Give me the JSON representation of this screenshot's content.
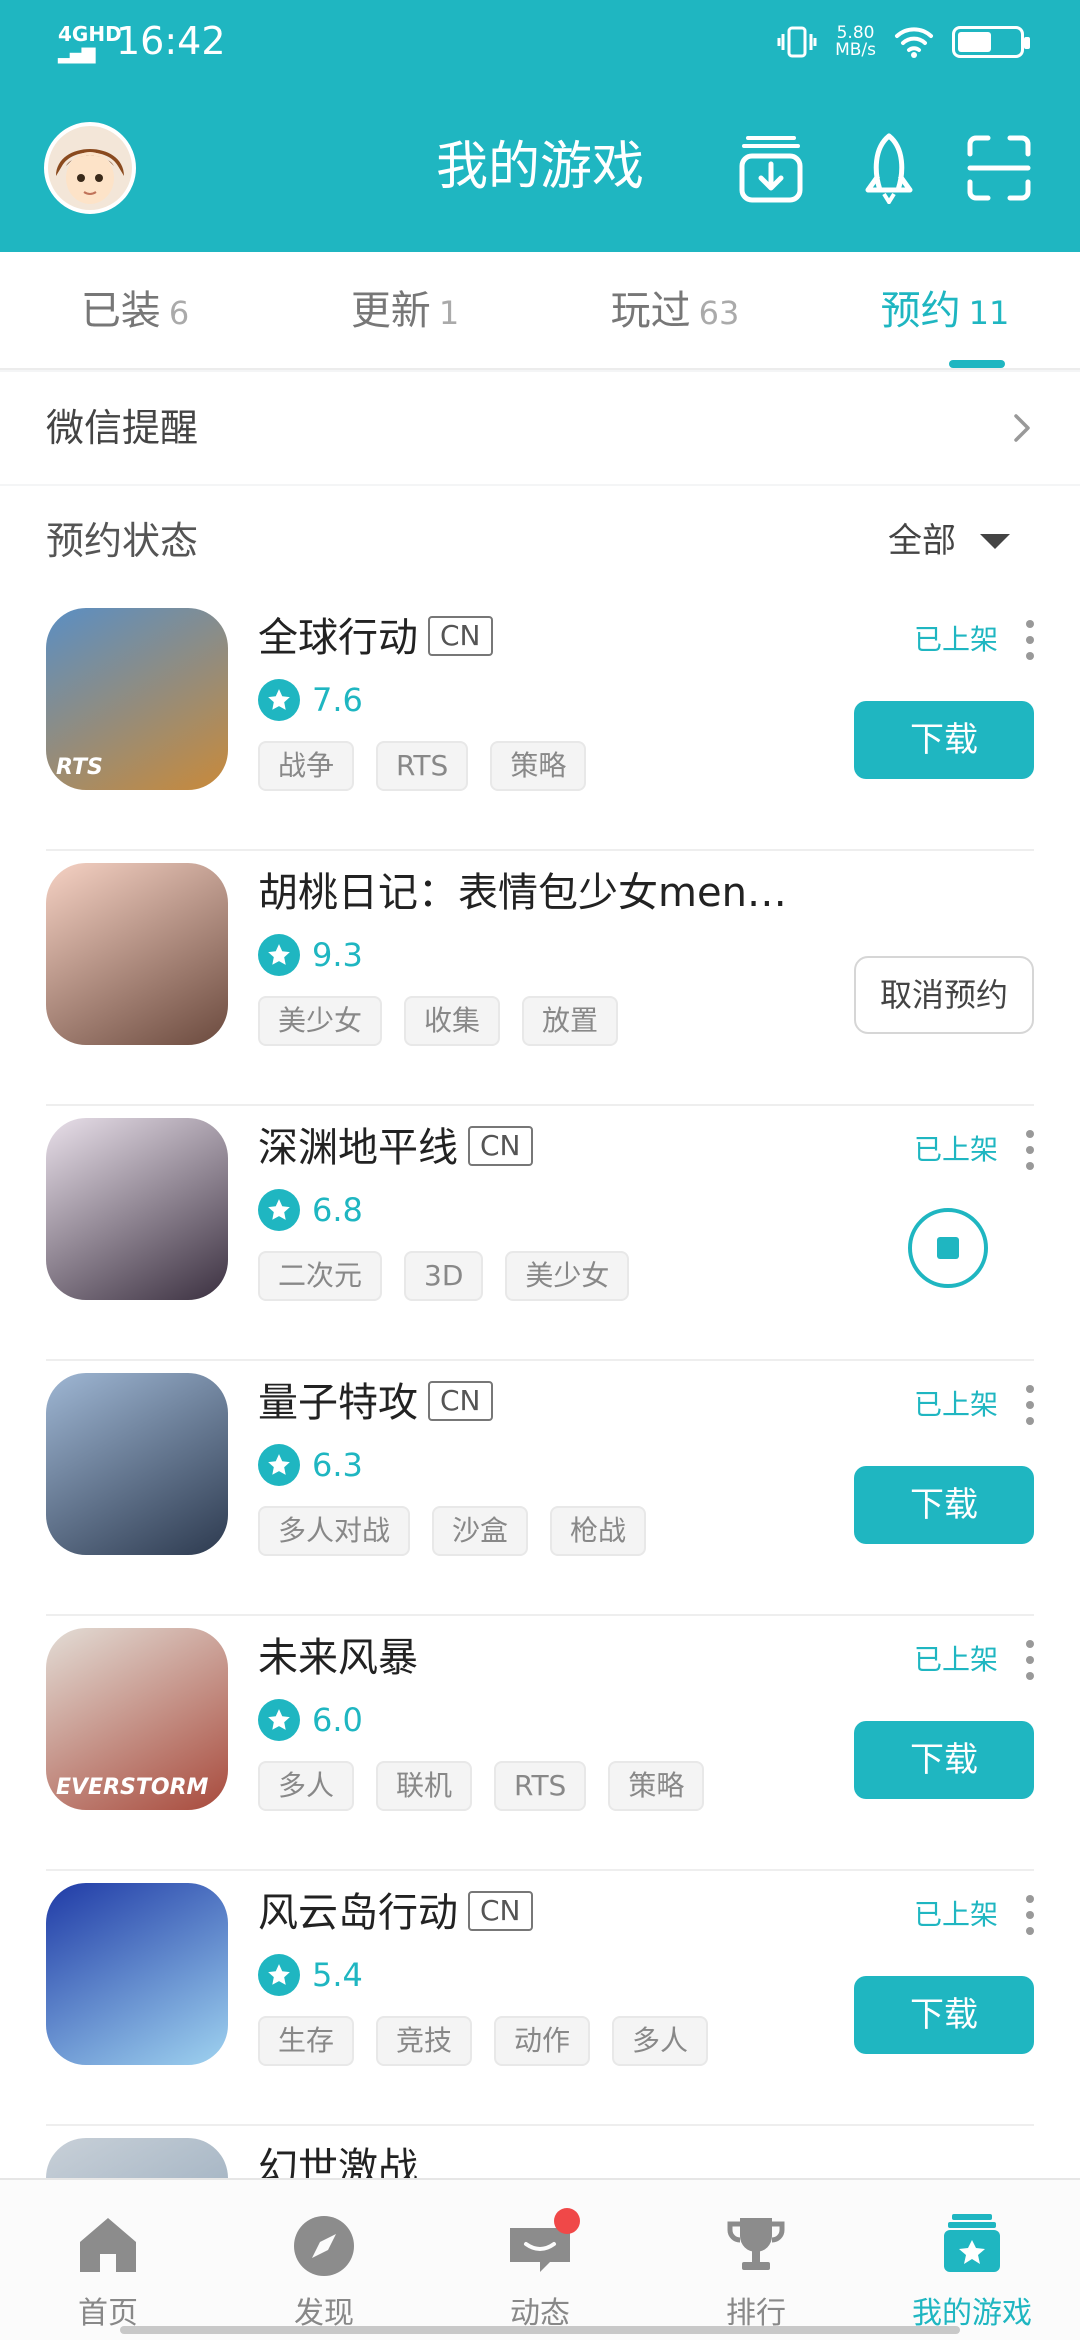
{
  "status_bar": {
    "network": "4GHD",
    "time": "16:42",
    "speed_value": "5.80",
    "speed_unit": "MB/s",
    "battery_level": 0.55
  },
  "header": {
    "title": "我的游戏"
  },
  "tabs": [
    {
      "label": "已装",
      "count": "6",
      "active": false
    },
    {
      "label": "更新",
      "count": "1",
      "active": false
    },
    {
      "label": "玩过",
      "count": "63",
      "active": false
    },
    {
      "label": "预约",
      "count": "11",
      "active": true
    }
  ],
  "wechat": {
    "label": "微信提醒"
  },
  "reservation": {
    "label": "预约状态",
    "filter": "全部"
  },
  "games": [
    {
      "name": "全球行动",
      "badge": "CN",
      "score": "7.6",
      "tags": [
        "战争",
        "RTS",
        "策略"
      ],
      "status": "已上架",
      "action": "download",
      "action_label": "下载",
      "icon_colors": [
        "#5a8fc4",
        "#c98a3a"
      ],
      "icon_text": "RTS"
    },
    {
      "name": "胡桃日记：表情包少女men…",
      "badge": "",
      "score": "9.3",
      "tags": [
        "美少女",
        "收集",
        "放置"
      ],
      "status": "",
      "action": "cancel",
      "action_label": "取消预约",
      "icon_colors": [
        "#f6d2c4",
        "#6b4a3e"
      ],
      "icon_text": ""
    },
    {
      "name": "深渊地平线",
      "badge": "CN",
      "score": "6.8",
      "tags": [
        "二次元",
        "3D",
        "美少女"
      ],
      "status": "已上架",
      "action": "stop",
      "action_label": "",
      "icon_colors": [
        "#e9e0ea",
        "#3b3040"
      ],
      "icon_text": ""
    },
    {
      "name": "量子特攻",
      "badge": "CN",
      "score": "6.3",
      "tags": [
        "多人对战",
        "沙盒",
        "枪战"
      ],
      "status": "已上架",
      "action": "download",
      "action_label": "下载",
      "icon_colors": [
        "#9fb7d4",
        "#2d3a4f"
      ],
      "icon_text": ""
    },
    {
      "name": "未来风暴",
      "badge": "",
      "score": "6.0",
      "tags": [
        "多人",
        "联机",
        "RTS",
        "策略"
      ],
      "status": "已上架",
      "action": "download",
      "action_label": "下载",
      "icon_colors": [
        "#e3ddd6",
        "#a84a3c"
      ],
      "icon_text": "EVERSTORM"
    },
    {
      "name": "风云岛行动",
      "badge": "CN",
      "score": "5.4",
      "tags": [
        "生存",
        "竞技",
        "动作",
        "多人"
      ],
      "status": "已上架",
      "action": "download",
      "action_label": "下载",
      "icon_colors": [
        "#1f3aa6",
        "#9fd3f0"
      ],
      "icon_text": ""
    },
    {
      "name": "幻世激战",
      "badge": "",
      "score": "",
      "tags": [],
      "status": "",
      "action": "",
      "action_label": "",
      "icon_colors": [
        "#c8d0d8",
        "#8aa0b4"
      ],
      "icon_text": ""
    }
  ],
  "bottom_nav": [
    {
      "label": "首页",
      "icon": "home-icon",
      "active": false
    },
    {
      "label": "发现",
      "icon": "compass-icon",
      "active": false
    },
    {
      "label": "动态",
      "icon": "chat-icon",
      "active": false,
      "badge": true
    },
    {
      "label": "排行",
      "icon": "trophy-icon",
      "active": false
    },
    {
      "label": "我的游戏",
      "icon": "my-games-icon",
      "active": true
    }
  ],
  "colors": {
    "accent": "#1fb6c1",
    "badge_red": "#f04848"
  }
}
